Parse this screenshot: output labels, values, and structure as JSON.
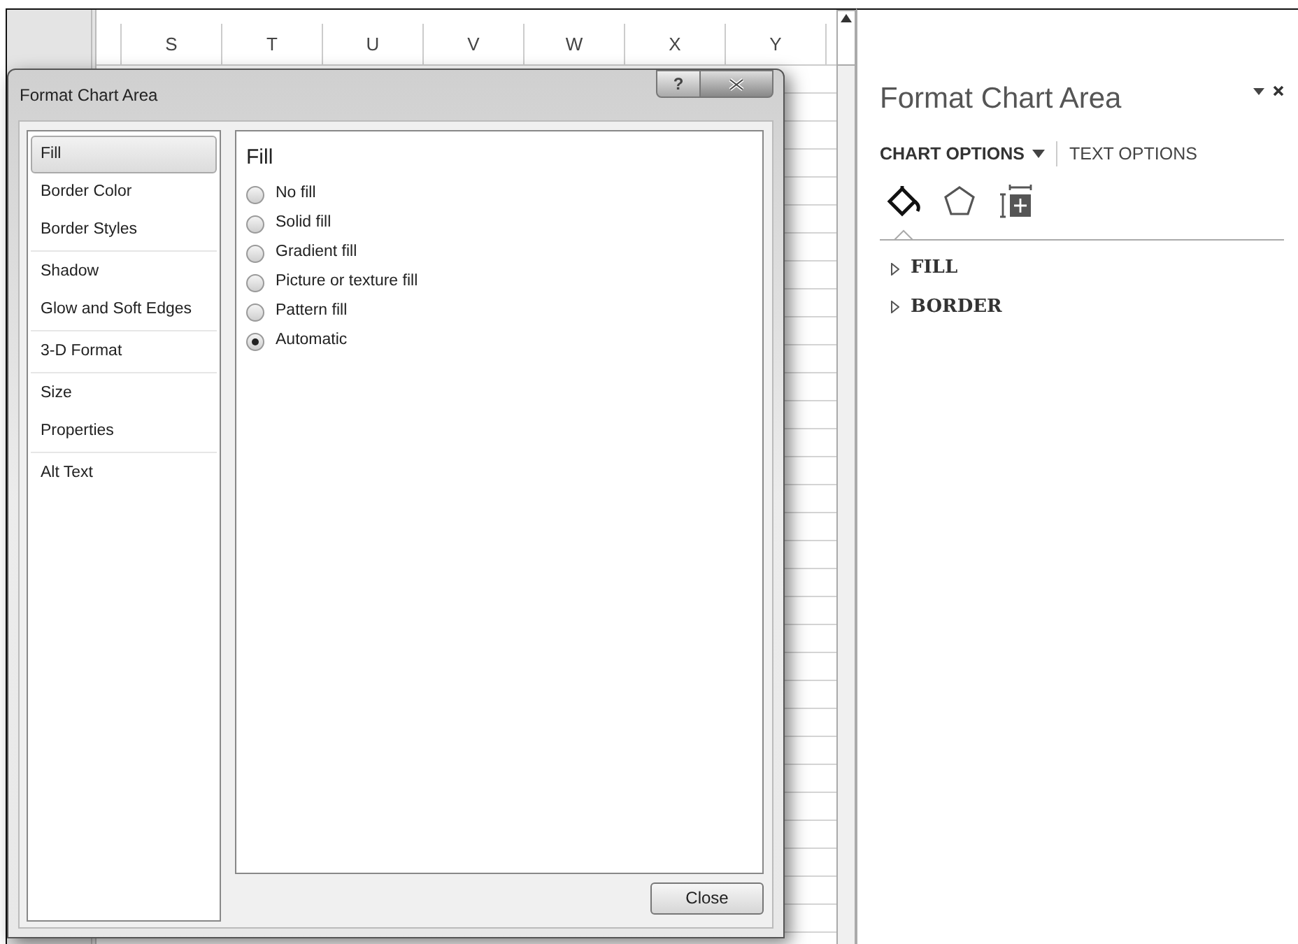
{
  "spreadsheet": {
    "columns": [
      "S",
      "T",
      "U",
      "V",
      "W",
      "X",
      "Y"
    ]
  },
  "dialog": {
    "title": "Format Chart Area",
    "help_glyph": "?",
    "category_groups": [
      [
        {
          "label": "Fill",
          "selected": true
        },
        {
          "label": "Border Color",
          "selected": false
        },
        {
          "label": "Border Styles",
          "selected": false
        }
      ],
      [
        {
          "label": "Shadow",
          "selected": false
        },
        {
          "label": "Glow and Soft Edges",
          "selected": false
        }
      ],
      [
        {
          "label": "3-D Format",
          "selected": false
        }
      ],
      [
        {
          "label": "Size",
          "selected": false
        },
        {
          "label": "Properties",
          "selected": false
        }
      ],
      [
        {
          "label": "Alt Text",
          "selected": false
        }
      ]
    ],
    "section_title": "Fill",
    "options": [
      {
        "label": "No fill",
        "selected": false
      },
      {
        "label": "Solid fill",
        "selected": false
      },
      {
        "label": "Gradient fill",
        "selected": false
      },
      {
        "label": "Picture or texture fill",
        "selected": false
      },
      {
        "label": "Pattern fill",
        "selected": false
      },
      {
        "label": "Automatic",
        "selected": true
      }
    ],
    "close_button": "Close"
  },
  "pane": {
    "title": "Format Chart Area",
    "tabs": [
      {
        "label": "CHART OPTIONS",
        "selected": true
      },
      {
        "label": "TEXT OPTIONS",
        "selected": false
      }
    ],
    "icon_tabs": [
      {
        "kind": "fill",
        "selected": true
      },
      {
        "kind": "effects",
        "selected": false
      },
      {
        "kind": "size",
        "selected": false
      }
    ],
    "sections": [
      {
        "label": "FILL",
        "expanded": false
      },
      {
        "label": "BORDER",
        "expanded": false
      }
    ]
  }
}
